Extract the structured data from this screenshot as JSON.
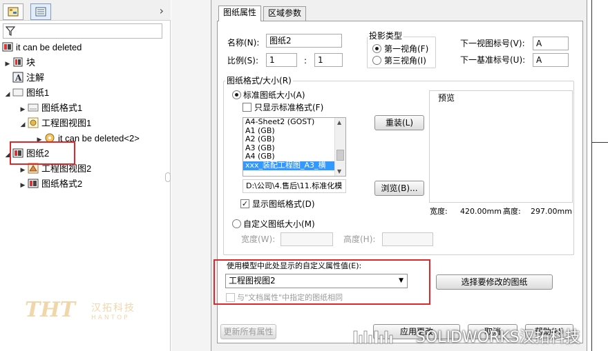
{
  "tree": {
    "root_label": "it can be deleted",
    "items": [
      {
        "label": "块"
      },
      {
        "label": "注解"
      },
      {
        "label": "图纸1"
      },
      {
        "label": "图纸格式1"
      },
      {
        "label": "工程图视图1"
      },
      {
        "label": "it can be deleted<2>"
      },
      {
        "label": "图纸2"
      },
      {
        "label": "工程图视图2"
      },
      {
        "label": "图纸格式2"
      }
    ]
  },
  "watermark": {
    "logo_text": "THT",
    "logo_cn": "汉拓科技",
    "logo_en": "HANTOP",
    "bottom_text": "SOLIDWORKS汉拓科技"
  },
  "dialog": {
    "tabs": [
      "图纸属性",
      "区域参数"
    ],
    "name_label": "名称(N):",
    "name_value": "图纸2",
    "scale_label": "比例(S):",
    "scale_num": "1",
    "scale_sep": ":",
    "scale_den": "1",
    "projection": {
      "title": "投影类型",
      "first_angle": "第一视角(F)",
      "third_angle": "第三视角(I)"
    },
    "next_view_label": "下一视图标号(V):",
    "next_view_value": "A",
    "next_datum_label": "下一基准标号(U):",
    "next_datum_value": "A",
    "format": {
      "title": "图纸格式/大小(R)",
      "standard": "标准图纸大小(A)",
      "only_standard": "只显示标准格式(F)",
      "list": [
        "A4-Sheet2 (GOST)",
        "A1 (GB)",
        "A2 (GB)",
        "A3 (GB)",
        "A4 (GB)",
        "xxx_装配工程图_A3_横"
      ],
      "selected_index": 5,
      "reload": "重装(L)",
      "path": "D:\\公司\\4.售后\\11.标准化模",
      "browse": "浏览(B)...",
      "show_format": "显示图纸格式(D)",
      "custom": "自定义图纸大小(M)",
      "width_label": "宽度(W):",
      "height_label": "高度(H):"
    },
    "preview": {
      "title": "预览",
      "width_label": "宽度:",
      "width_value": "420.00mm",
      "height_label": "高度:",
      "height_value": "297.00mm"
    },
    "custom_props_label": "使用模型中此处显示的自定义属性值(E):",
    "custom_props_value": "工程图视图2",
    "same_as_doc": "与\"文档属性\"中指定的图纸相同",
    "select_sheets": "选择要修改的图纸",
    "update_all": "更新所有属性",
    "apply": "应用更改",
    "cancel": "取消",
    "help": "帮助(H)"
  }
}
